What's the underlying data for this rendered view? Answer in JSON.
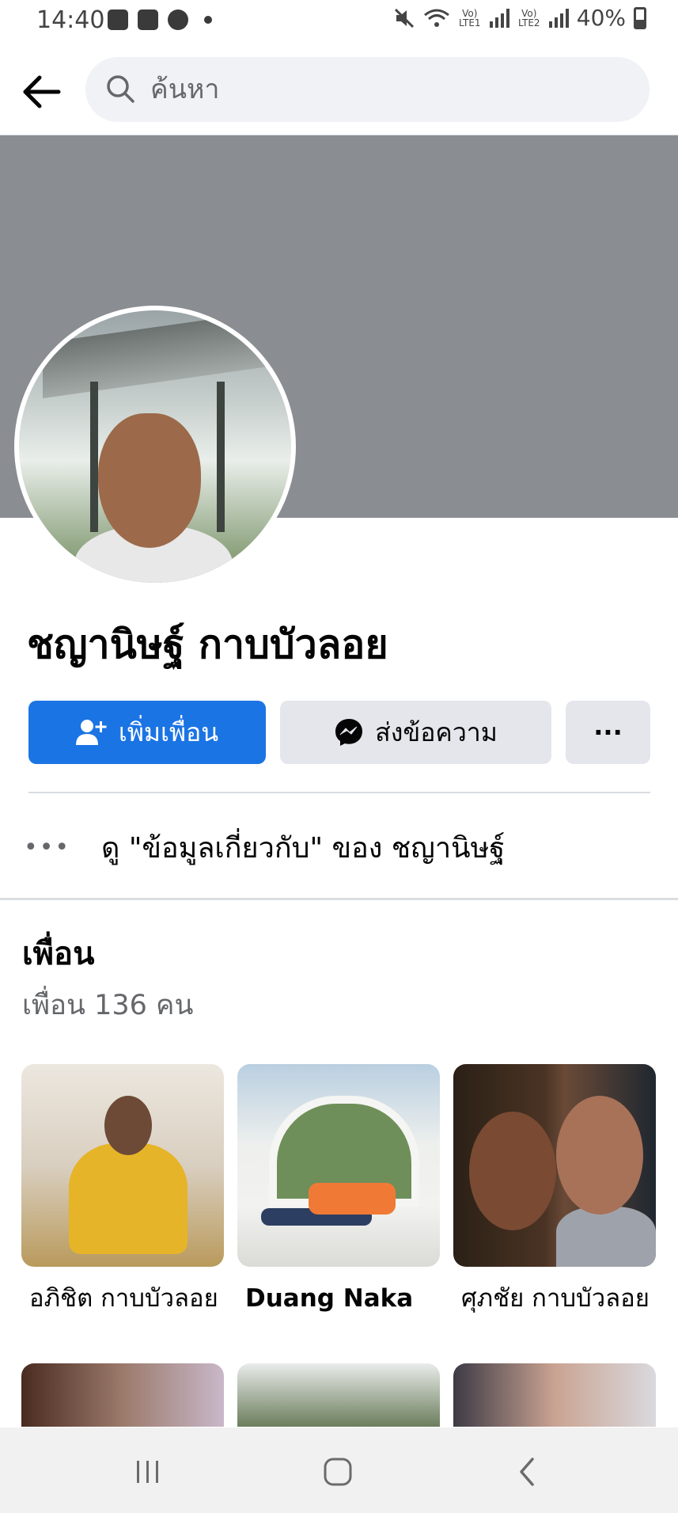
{
  "status_bar": {
    "time": "14:40",
    "left_icons": [
      "gallery-icon",
      "play-icon",
      "line-icon"
    ],
    "sim1_label": "Vo) LTE1",
    "sim2_label": "Vo) LTE2",
    "battery": "40%"
  },
  "search": {
    "placeholder": "ค้นหา"
  },
  "profile": {
    "name": "ชญานิษฐ์ กาบบัวลอย",
    "add_friend_label": "เพิ่มเพื่อน",
    "message_label": "ส่งข้อความ",
    "more_label": "···",
    "about_link": "ดู \"ข้อมูลเกี่ยวกับ\" ของ ชญานิษฐ์"
  },
  "friends": {
    "title": "เพื่อน",
    "count": "เพื่อน 136 คน",
    "items": [
      {
        "name": "อภิชิต กาบบัวลอย"
      },
      {
        "name": "Duang Naka"
      },
      {
        "name": "ศุภชัย กาบบัวลอย"
      }
    ]
  },
  "colors": {
    "accent": "#1b74e4",
    "cover": "#8a8d91",
    "secondary_button": "#e4e6eb"
  }
}
